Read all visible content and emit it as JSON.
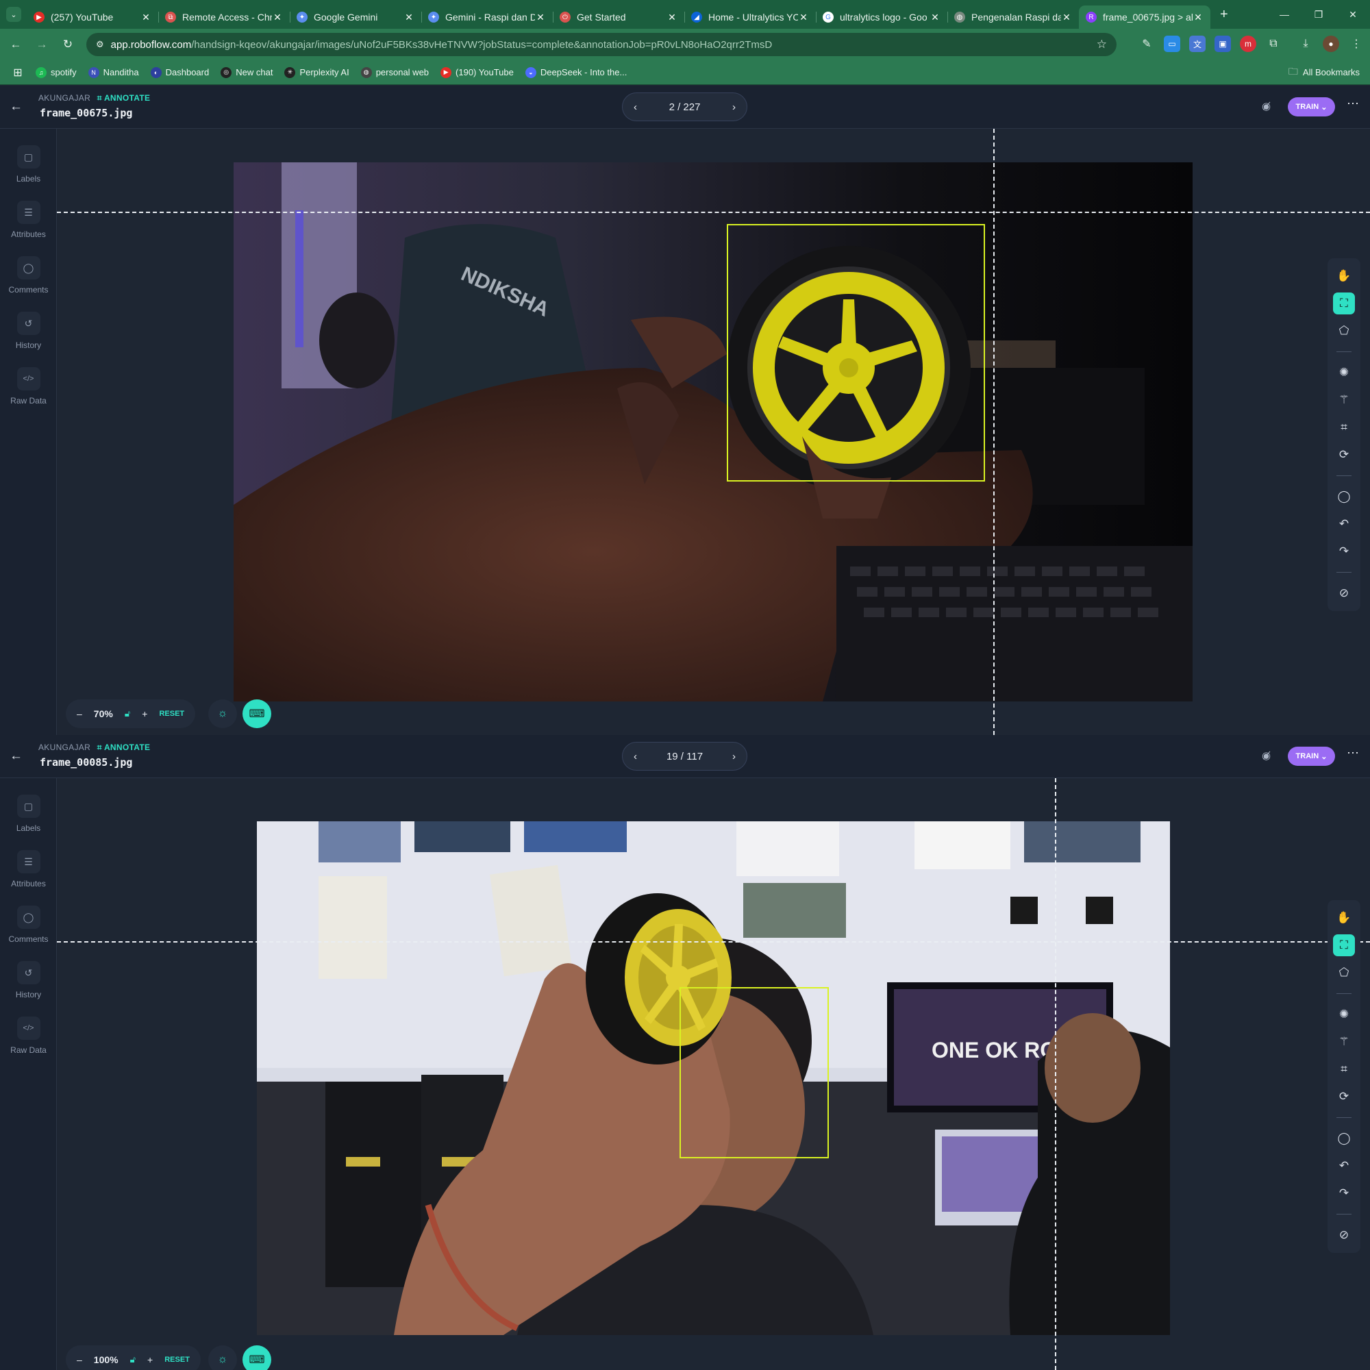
{
  "browser": {
    "tabs": [
      {
        "title": "(257) YouTube",
        "icon": "youtube-icon",
        "color": "#e52d27",
        "glyph": "▶"
      },
      {
        "title": "Remote Access - Chrom",
        "icon": "remote-access-icon",
        "color": "#d9534f",
        "glyph": "⧉"
      },
      {
        "title": "Google Gemini",
        "icon": "gemini-icon",
        "color": "#5b8def",
        "glyph": "✦"
      },
      {
        "title": "Gemini - Raspi dan D",
        "icon": "gemini-icon",
        "color": "#5b8def",
        "glyph": "✦"
      },
      {
        "title": "Get Started",
        "icon": "power-icon",
        "color": "#d9534f",
        "glyph": "⏻"
      },
      {
        "title": "Home - Ultralytics YO",
        "icon": "ultralytics-icon",
        "color": "#0b63d8",
        "glyph": "◢"
      },
      {
        "title": "ultralytics logo - Goo",
        "icon": "google-icon",
        "color": "#ffffff",
        "glyph": "G"
      },
      {
        "title": "Pengenalan Raspi dan",
        "icon": "globe-icon",
        "color": "#7a8a80",
        "glyph": "◍"
      },
      {
        "title": "frame_00675.jpg > al",
        "icon": "roboflow-icon",
        "color": "#8a3ffc",
        "glyph": "R"
      }
    ],
    "url_host": "app.roboflow.com",
    "url_path": "/handsign-kqeov/akungajar/images/uNof2uF5BKs38vHeTNVW?jobStatus=complete&annotationJob=pR0vLN8oHaO2qrr2TmsD",
    "bookmarks": [
      {
        "label": "spotify",
        "icon": "spotify-icon",
        "color": "#1db954",
        "glyph": "♫"
      },
      {
        "label": "Nanditha",
        "icon": "bookmark-n-icon",
        "color": "#3b4fb8",
        "glyph": "N"
      },
      {
        "label": "Dashboard",
        "icon": "dashboard-icon",
        "color": "#2d3f9e",
        "glyph": "◐"
      },
      {
        "label": "New chat",
        "icon": "openai-icon",
        "color": "#222222",
        "glyph": "◎"
      },
      {
        "label": "Perplexity AI",
        "icon": "perplexity-icon",
        "color": "#222222",
        "glyph": "✳"
      },
      {
        "label": "personal web",
        "icon": "globe-icon",
        "color": "#444444",
        "glyph": "◍"
      },
      {
        "label": "(190) YouTube",
        "icon": "youtube-icon",
        "color": "#e52d27",
        "glyph": "▶"
      },
      {
        "label": "DeepSeek - Into the...",
        "icon": "deepseek-icon",
        "color": "#4d6bfe",
        "glyph": "◒"
      }
    ],
    "all_bookmarks": "All Bookmarks"
  },
  "common": {
    "workspace": "AKUNGAJAR",
    "mode": "ANNOTATE",
    "train": "TRAIN",
    "reset": "RESET",
    "sidebar": [
      {
        "label": "Labels",
        "icon": "labels-icon",
        "glyph": "▢"
      },
      {
        "label": "Attributes",
        "icon": "attributes-icon",
        "glyph": "☰"
      },
      {
        "label": "Comments",
        "icon": "comments-icon",
        "glyph": "◯"
      },
      {
        "label": "History",
        "icon": "history-icon",
        "glyph": "↺"
      },
      {
        "label": "Raw Data",
        "icon": "code-icon",
        "glyph": "</>"
      }
    ],
    "accent": "#2fe0c4",
    "bbox_color": "#d9f222",
    "train_color": "#9b6cf4"
  },
  "panel1": {
    "filename": "frame_00675.jpg",
    "position": "2 / 227",
    "zoom": "70%"
  },
  "panel2": {
    "filename": "frame_00085.jpg",
    "position": "19 / 117",
    "zoom": "100%"
  }
}
